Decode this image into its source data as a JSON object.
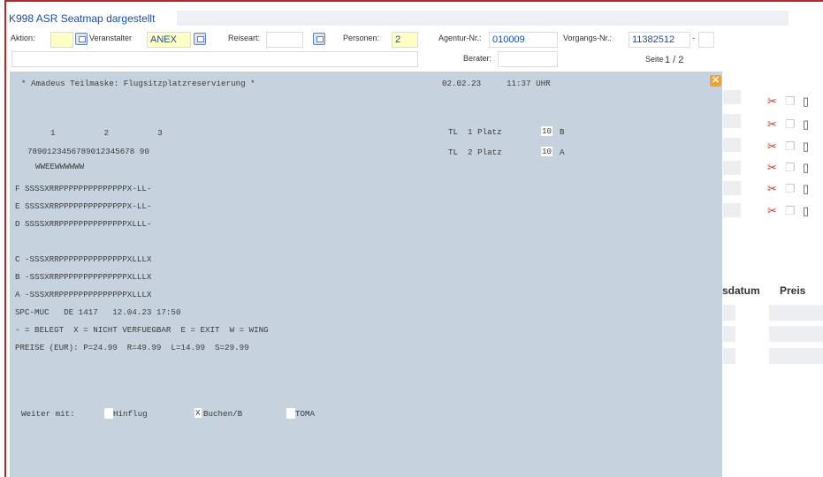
{
  "header": {
    "title": "K998 ASR Seatmap dargestellt",
    "aktion_label": "Aktion:",
    "veranstalter_label": "Veranstalter",
    "veranstalter_value": "ANEX",
    "reiseart_label": "Reiseart:",
    "personen_label": "Personen:",
    "personen_value": "2",
    "agentur_label": "Agentur-Nr.:",
    "agentur_value": "010009",
    "vorgangs_label": "Vorgangs-Nr.:",
    "vorgangs_value": "11382512",
    "vorgangs_sep": "-",
    "berater_label": "Berater:",
    "seite_label": "Seite",
    "seite_value": "1 / 2"
  },
  "terminal": {
    "headline": "* Amadeus Teilmaske: Flugsitzplatzreservierung *",
    "date": "02.02.23",
    "time": "11:37 UHR",
    "col_numbers": "1          2          3",
    "col_digits": "7890123456789012345678 90",
    "wing_row": "WWEEWWWWWW",
    "rows": [
      "F SSSSXRRPPPPPPPPPPPPPPX-LL-",
      "E SSSSXRRPPPPPPPPPPPPPPX-LL-",
      "D SSSSXRRPPPPPPPPPPPPPPXLLL-",
      "",
      "C -SSSXRRPPPPPPPPPPPPPPXLLLX",
      "B -SSSXRRPPPPPPPPPPPPPPXLLLX",
      "A -SSSXRRPPPPPPPPPPPPPPXLLLX"
    ],
    "flight_line": "SPC-MUC   DE 1417   12.04.23 17:50",
    "legend_line": "- = BELEGT  X = NICHT VERFUEGBAR  E = EXIT  W = WING",
    "price_line": "PREISE (EUR): P=24.99  R=49.99  L=14.99  S=29.99",
    "tl1_label": "TL  1 Platz",
    "tl1_row": "10",
    "tl1_seat": "B",
    "tl2_label": "TL  2 Platz",
    "tl2_row": "10",
    "tl2_seat": "A",
    "weiter_label": "Weiter mit:",
    "option1_label": "Hinflug",
    "option2_mark": "X",
    "option2_label": "Buchen/B",
    "option3_label": "TOMA"
  },
  "close_glyph": "✕",
  "right_panel": {
    "col1_header": "sdatum",
    "col2_header": "Preis",
    "icons": [
      "scissors-icon",
      "copy-icon",
      "clipboard-icon"
    ]
  },
  "colors": {
    "title_blue": "#1b4fa8",
    "panel_bg": "#c6d3de",
    "frame_red": "#b02a2a",
    "highlight_yellow": "#ffffc4",
    "close_orange": "#f3a22a"
  }
}
